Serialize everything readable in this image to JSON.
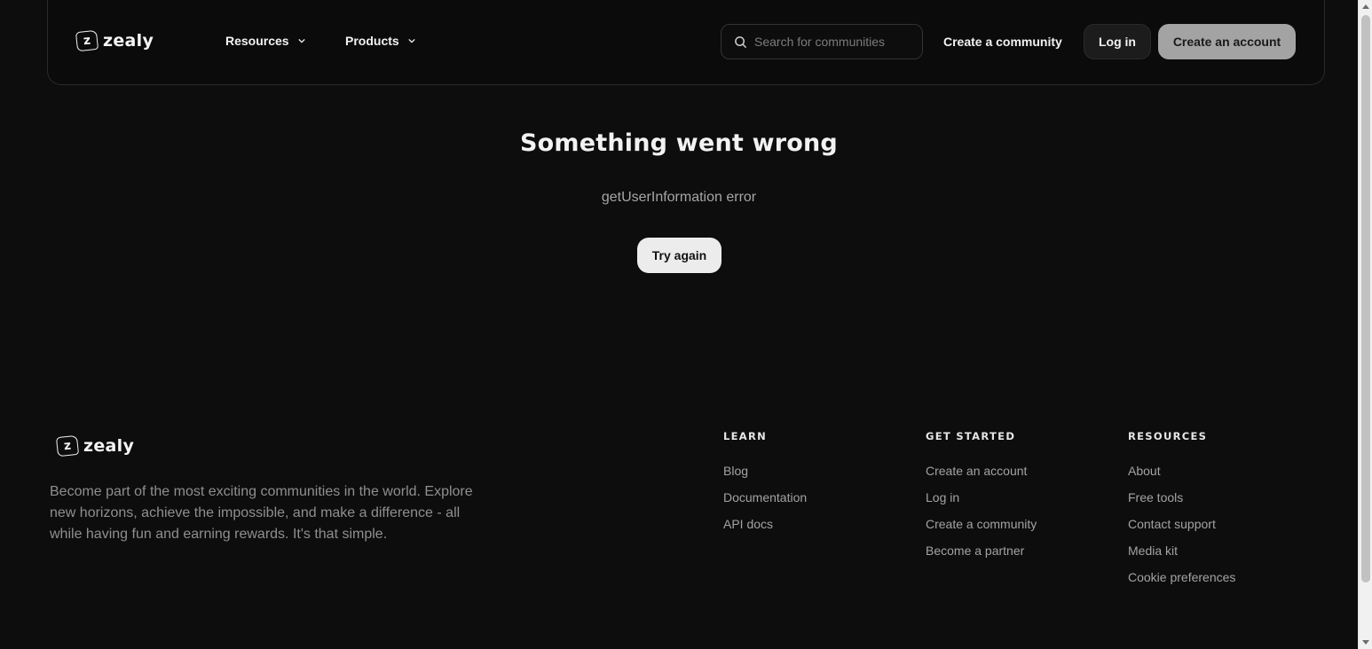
{
  "header": {
    "logo_text": "zealy",
    "nav": [
      {
        "label": "Resources"
      },
      {
        "label": "Products"
      }
    ],
    "search_placeholder": "Search for communities",
    "create_community": "Create a community",
    "login": "Log in",
    "create_account": "Create an account"
  },
  "error": {
    "title": "Something went wrong",
    "message": "getUserInformation error",
    "retry": "Try again"
  },
  "footer": {
    "logo_text": "zealy",
    "description": "Become part of the most exciting communities in the world. Explore new horizons, achieve the impossible, and make a difference - all while having fun and earning rewards. It's that simple.",
    "columns": [
      {
        "heading": "LEARN",
        "links": [
          "Blog",
          "Documentation",
          "API docs"
        ]
      },
      {
        "heading": "GET STARTED",
        "links": [
          "Create an account",
          "Log in",
          "Create a community",
          "Become a partner"
        ]
      },
      {
        "heading": "RESOURCES",
        "links": [
          "About",
          "Free tools",
          "Contact support",
          "Media kit",
          "Cookie preferences"
        ]
      }
    ]
  },
  "colors": {
    "background": "#0d0d0d",
    "create_account_button": "#a3a3a3",
    "try_again_button": "#ececec"
  }
}
